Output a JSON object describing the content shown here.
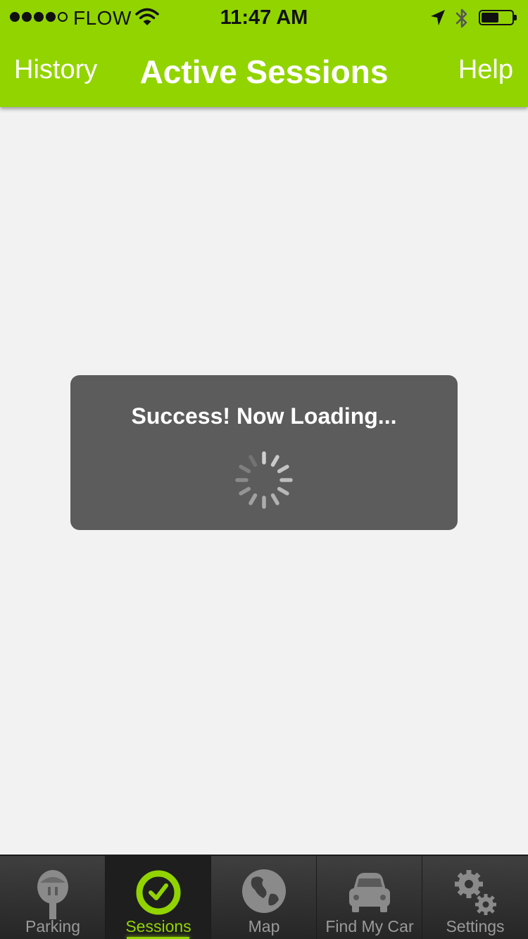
{
  "status_bar": {
    "carrier": "FLOW",
    "time": "11:47 AM",
    "signal_bars": 4,
    "signal_max": 5,
    "battery_level": 0.52
  },
  "nav_bar": {
    "left_label": "History",
    "title": "Active Sessions",
    "right_label": "Help"
  },
  "loading_hud": {
    "message": "Success! Now Loading...",
    "spinner_icon": "activity-spinner-icon"
  },
  "tab_bar": {
    "active_tab": "Sessions",
    "tabs": [
      {
        "label": "Parking",
        "icon": "parking-meter-icon"
      },
      {
        "label": "Sessions",
        "icon": "clock-check-icon"
      },
      {
        "label": "Map",
        "icon": "globe-icon"
      },
      {
        "label": "Find My Car",
        "icon": "car-icon"
      },
      {
        "label": "Settings",
        "icon": "gears-icon"
      }
    ]
  },
  "colors": {
    "accent": "#92d400",
    "hud_background": "#5c5c5c",
    "page_background": "#f2f2f2",
    "tab_bar_background": "#333333",
    "inactive_tab_label": "#9a9a9a"
  }
}
